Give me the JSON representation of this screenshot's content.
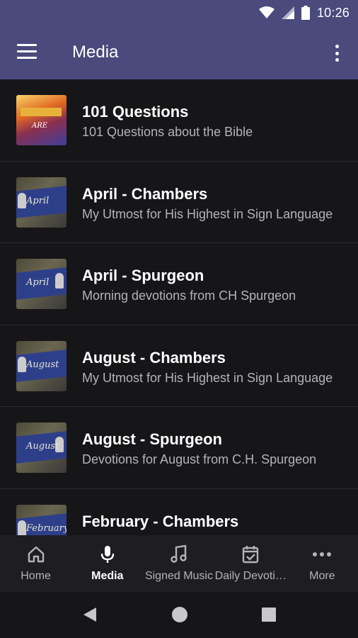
{
  "status_bar": {
    "time": "10:26"
  },
  "app_bar": {
    "title": "Media"
  },
  "media_items": [
    {
      "title": "101 Questions",
      "subtitle": "101 Questions about the Bible",
      "thumb_text": "ARE"
    },
    {
      "title": "April - Chambers",
      "subtitle": "My Utmost for His Highest in Sign Language",
      "thumb_text": "April"
    },
    {
      "title": "April - Spurgeon",
      "subtitle": "Morning devotions from CH Spurgeon",
      "thumb_text": "April"
    },
    {
      "title": "August - Chambers",
      "subtitle": "My Utmost for His Highest in Sign Language",
      "thumb_text": "August"
    },
    {
      "title": "August - Spurgeon",
      "subtitle": "Devotions for August from C.H. Spurgeon",
      "thumb_text": "August"
    },
    {
      "title": "February - Chambers",
      "subtitle": "",
      "thumb_text": "February"
    }
  ],
  "bottom_nav": [
    {
      "label": "Home",
      "icon": "home-icon"
    },
    {
      "label": "Media",
      "icon": "mic-icon",
      "active": true
    },
    {
      "label": "Signed Music",
      "icon": "music-note-icon"
    },
    {
      "label": "Daily Devoti…",
      "icon": "calendar-check-icon"
    },
    {
      "label": "More",
      "icon": "more-horizontal-icon"
    }
  ],
  "colors": {
    "app_bar": "#4a4a7d",
    "background": "#161618",
    "nav_background": "#1e1e21",
    "secondary_text": "#b4b4b8"
  }
}
